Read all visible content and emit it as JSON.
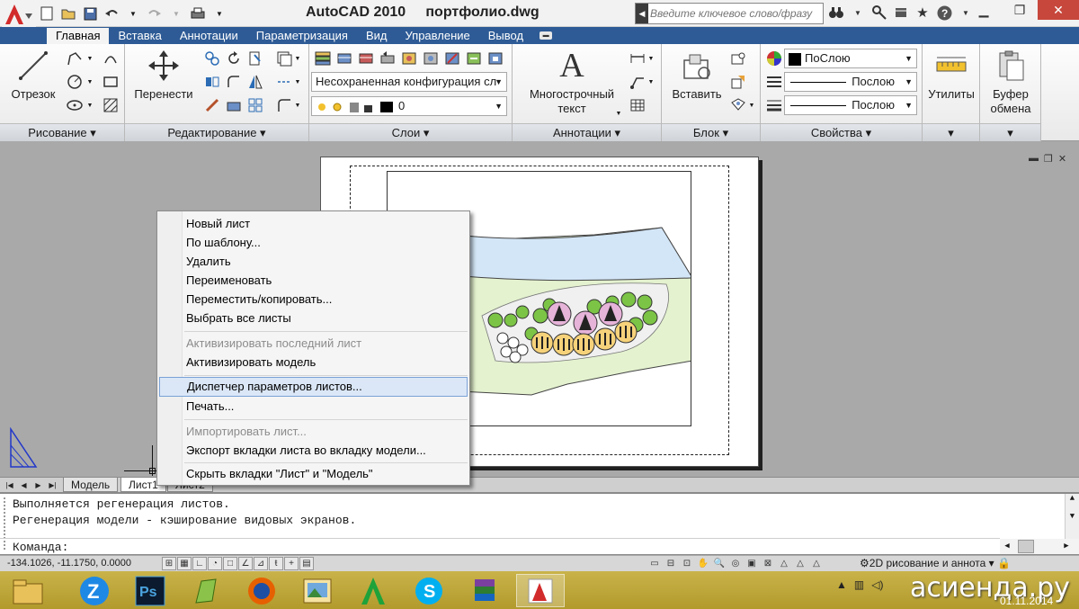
{
  "window": {
    "app_name": "AutoCAD 2010",
    "file_name": "портфолио.dwg",
    "search_placeholder": "Введите ключевое слово/фразу"
  },
  "ribbon_tabs": [
    {
      "label": "Главная",
      "active": true
    },
    {
      "label": "Вставка"
    },
    {
      "label": "Аннотации"
    },
    {
      "label": "Параметризация"
    },
    {
      "label": "Вид"
    },
    {
      "label": "Управление"
    },
    {
      "label": "Вывод"
    }
  ],
  "panels": {
    "draw": {
      "title": "Рисование",
      "line_label": "Отрезок"
    },
    "modify": {
      "title": "Редактирование",
      "move_label": "Перенести"
    },
    "layers": {
      "title": "Слои",
      "state_value": "Несохраненная конфигурация сл",
      "current_layer": "0"
    },
    "annotations": {
      "title": "Аннотации",
      "mtext_label_1": "Многострочный",
      "mtext_label_2": "текст"
    },
    "block": {
      "title": "Блок",
      "insert_label": "Вставить"
    },
    "properties": {
      "title": "Свойства",
      "color_value": "ПоСлою",
      "linetype_value": "Послою",
      "lineweight_value": "Послою"
    },
    "utilities": {
      "label": "Утилиты"
    },
    "clipboard": {
      "label_1": "Буфер",
      "label_2": "обмена"
    }
  },
  "layout_tabs": {
    "model": "Модель",
    "sheet1": "Лист1",
    "sheet2": "Лист2"
  },
  "context_menu": {
    "items": [
      {
        "label": "Новый лист"
      },
      {
        "label": "По шаблону..."
      },
      {
        "label": "Удалить"
      },
      {
        "label": "Переименовать"
      },
      {
        "label": "Переместить/копировать..."
      },
      {
        "label": "Выбрать все листы"
      },
      {
        "label": "Активизировать последний лист",
        "disabled": true
      },
      {
        "label": "Активизировать модель"
      },
      {
        "label": "Диспетчер параметров листов...",
        "highlighted": true
      },
      {
        "label": "Печать..."
      },
      {
        "label": "Импортировать лист...",
        "disabled": true
      },
      {
        "label": "Экспорт вкладки листа во вкладку модели..."
      },
      {
        "label": "Скрыть вкладки \"Лист\" и \"Модель\""
      }
    ]
  },
  "command_line": {
    "history": [
      "Выполняется регенерация листов.",
      "Регенерация модели - кэширование видовых экранов."
    ],
    "prompt": "Команда:"
  },
  "status_bar": {
    "coordinates": "-134.1026, -11.1750, 0.0000",
    "workspace": "2D рисование и аннота"
  },
  "taskbar": {
    "watermark": "асиенда.ру",
    "date": "01.11.2014",
    "apps": [
      "file-explorer",
      "zoom",
      "photoshop",
      "sketchbook",
      "firefox",
      "image-viewer",
      "autocad-a",
      "skype",
      "winrar",
      "autocad-2010"
    ]
  },
  "colors": {
    "ribbon_tab_bar": "#2e5b96",
    "menu_highlight": "#dbe7f7",
    "taskbar": "#c0a83a",
    "drawing_bg": "#a9a9a9"
  }
}
